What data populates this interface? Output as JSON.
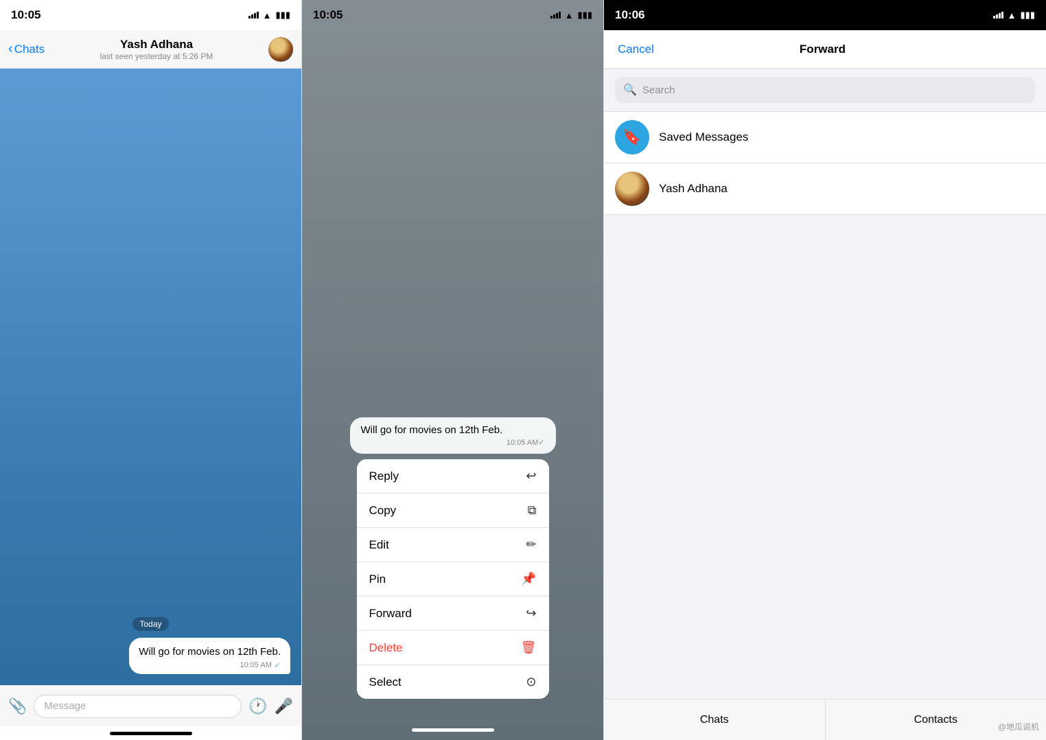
{
  "panel1": {
    "statusBar": {
      "time": "10:05"
    },
    "header": {
      "backLabel": "Chats",
      "contactName": "Yash Adhana",
      "statusText": "last seen yesterday at 5:26 PM"
    },
    "chat": {
      "dateBadge": "Today",
      "message": {
        "text": "Will go for movies on 12th Feb.",
        "time": "10:05 AM",
        "tick": "✓"
      }
    },
    "inputBar": {
      "placeholder": "Message"
    }
  },
  "panel2": {
    "statusBar": {
      "time": "10:05"
    },
    "message": {
      "text": "Will go for movies on 12th Feb.",
      "time": "10:05 AM✓"
    },
    "contextMenu": {
      "items": [
        {
          "label": "Reply",
          "icon": "↩",
          "isDelete": false
        },
        {
          "label": "Copy",
          "icon": "⧉",
          "isDelete": false
        },
        {
          "label": "Edit",
          "icon": "✎",
          "isDelete": false
        },
        {
          "label": "Pin",
          "icon": "📌",
          "isDelete": false
        },
        {
          "label": "Forward",
          "icon": "↪",
          "isDelete": false
        },
        {
          "label": "Delete",
          "icon": "🗑",
          "isDelete": true
        },
        {
          "label": "Select",
          "icon": "◎",
          "isDelete": false
        }
      ]
    }
  },
  "panel3": {
    "statusBar": {
      "time": "10:06"
    },
    "header": {
      "cancelLabel": "Cancel",
      "title": "Forward"
    },
    "search": {
      "placeholder": "Search"
    },
    "contacts": [
      {
        "name": "Saved Messages",
        "type": "saved"
      },
      {
        "name": "Yash Adhana",
        "type": "yash"
      }
    ],
    "tabs": [
      {
        "label": "Chats"
      },
      {
        "label": "Contacts"
      }
    ]
  },
  "watermark": "@地瓜说机"
}
